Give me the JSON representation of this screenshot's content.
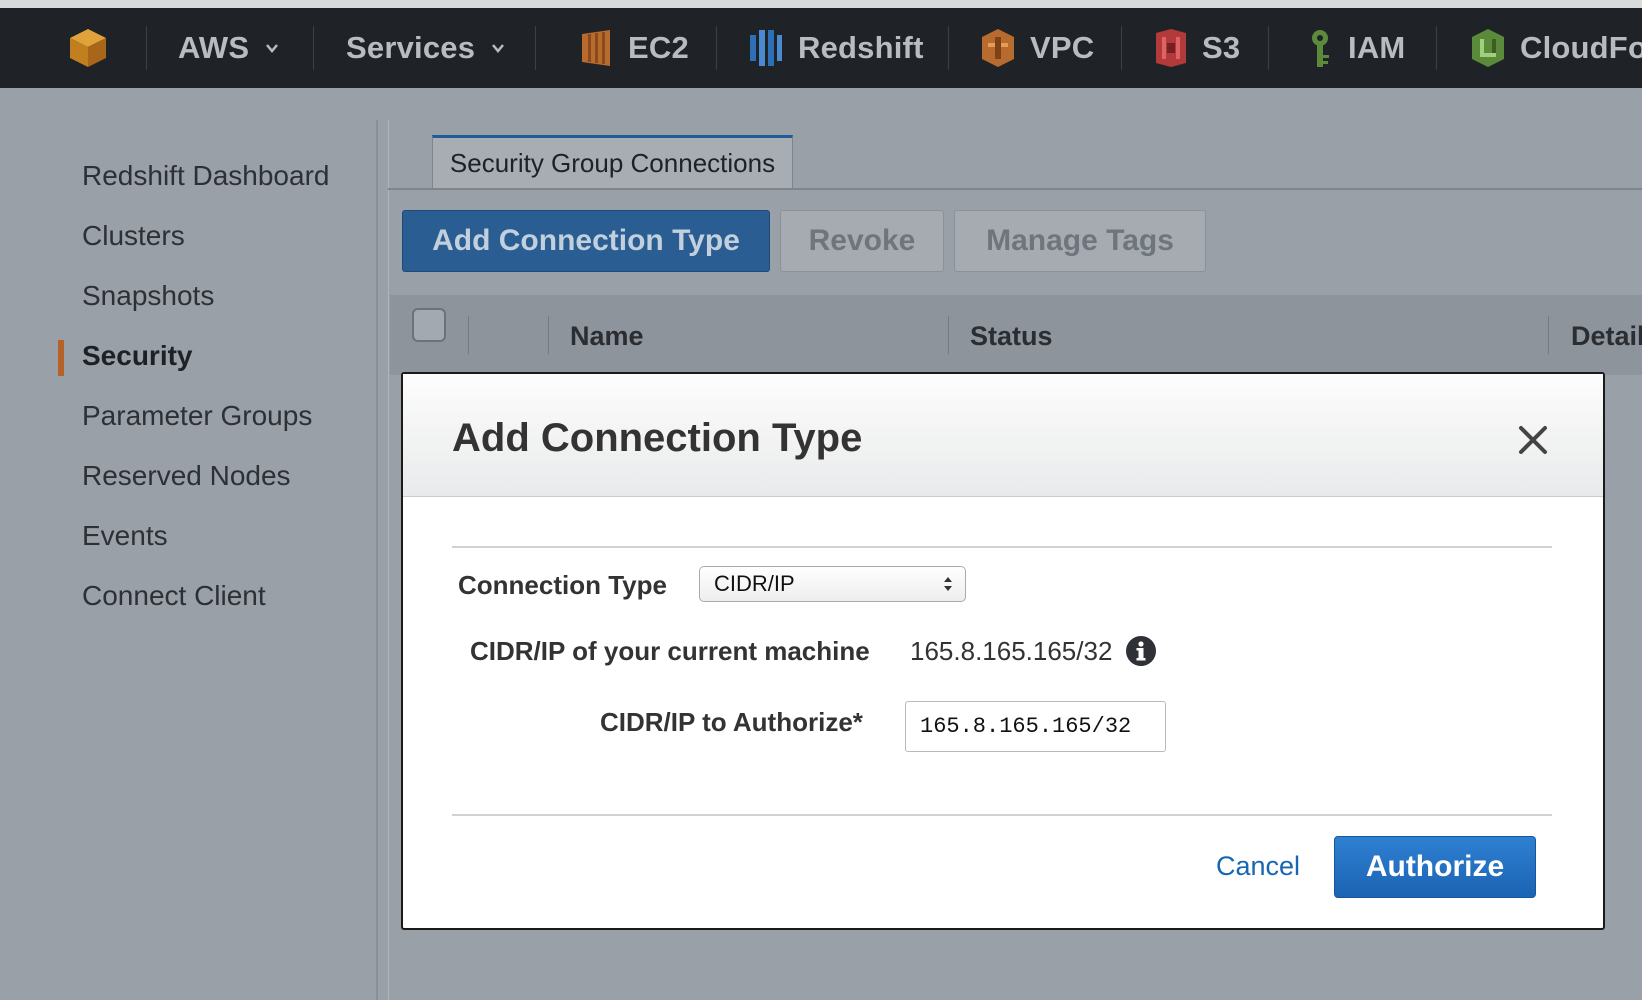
{
  "nav": {
    "aws_label": "AWS",
    "services_label": "Services",
    "items": [
      {
        "label": "EC2",
        "icon": "ec2-icon",
        "color": "#b86b2e"
      },
      {
        "label": "Redshift",
        "icon": "redshift-icon",
        "color": "#2f6fb3"
      },
      {
        "label": "VPC",
        "icon": "vpc-icon",
        "color": "#b86b2e"
      },
      {
        "label": "S3",
        "icon": "s3-icon",
        "color": "#b23a3a"
      },
      {
        "label": "IAM",
        "icon": "iam-icon",
        "color": "#5b8a3a"
      },
      {
        "label": "CloudFo",
        "icon": "cloudformation-icon",
        "color": "#5b8a3a"
      }
    ]
  },
  "sidebar": {
    "items": [
      {
        "label": "Redshift Dashboard"
      },
      {
        "label": "Clusters"
      },
      {
        "label": "Snapshots"
      },
      {
        "label": "Security",
        "active": true
      },
      {
        "label": "Parameter Groups"
      },
      {
        "label": "Reserved Nodes"
      },
      {
        "label": "Events"
      },
      {
        "label": "Connect Client"
      }
    ]
  },
  "main": {
    "tab_label": "Security Group Connections",
    "toolbar": {
      "add_label": "Add Connection Type",
      "revoke_label": "Revoke",
      "manage_tags_label": "Manage Tags"
    },
    "columns": [
      "Name",
      "Status",
      "Detail"
    ]
  },
  "modal": {
    "title": "Add Connection Type",
    "connection_type_label": "Connection Type",
    "connection_type_value": "CIDR/IP",
    "current_machine_label": "CIDR/IP of your current machine",
    "current_machine_value": "165.8.165.165/32",
    "authorize_label": "CIDR/IP to Authorize*",
    "authorize_value": "165.8.165.165/32",
    "cancel_label": "Cancel",
    "authorize_button_label": "Authorize"
  },
  "colors": {
    "nav_bg": "#1f2327",
    "primary_button": "#1b63b3",
    "active_marker": "#b4622a",
    "link": "#1766b5"
  }
}
